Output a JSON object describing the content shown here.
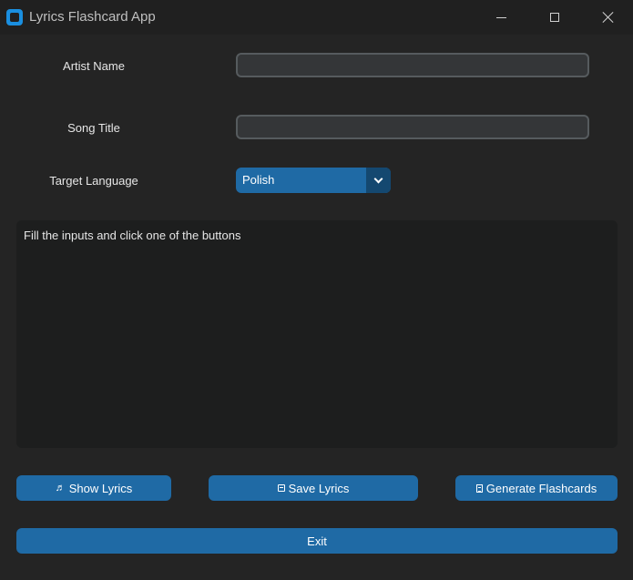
{
  "window": {
    "title": "Lyrics Flashcard App",
    "icon": "app-icon"
  },
  "colors": {
    "background": "#242424",
    "titlebar": "#202020",
    "accent": "#1f6aa5",
    "accent_dark": "#144870",
    "entry_bg": "#343638",
    "entry_border": "#565b5e",
    "textbox_bg": "#1d1e1e"
  },
  "form": {
    "artist": {
      "label": "Artist Name",
      "value": "",
      "placeholder": ""
    },
    "song": {
      "label": "Song Title",
      "value": "",
      "placeholder": ""
    },
    "language": {
      "label": "Target Language",
      "selected": "Polish"
    }
  },
  "output": {
    "text": "Fill the inputs and click one of the buttons"
  },
  "buttons": {
    "show_lyrics": {
      "label": "Show Lyrics",
      "icon": "music-note-icon",
      "glyph": "♬"
    },
    "save_lyrics": {
      "label": "Save Lyrics",
      "icon": "floppy-disk-icon"
    },
    "generate_flashcards": {
      "label": "Generate Flashcards",
      "icon": "document-icon"
    },
    "exit": {
      "label": "Exit"
    }
  }
}
